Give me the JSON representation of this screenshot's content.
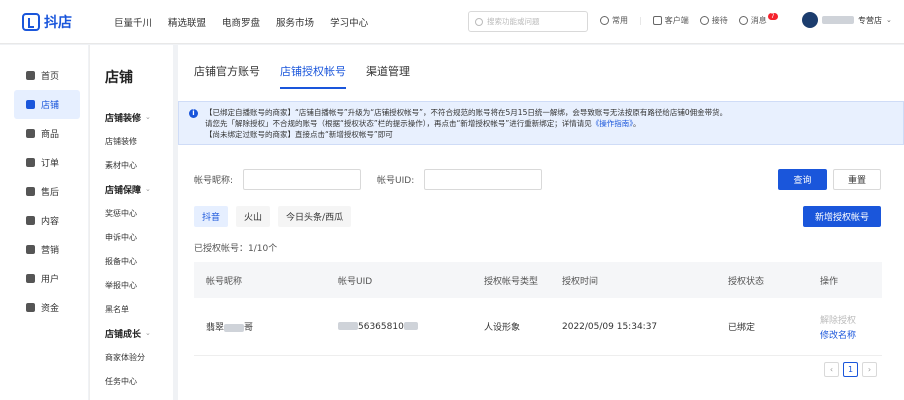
{
  "brand": {
    "name": "抖店"
  },
  "topnav": [
    "巨量千川",
    "精选联盟",
    "电商罗盘",
    "服务市场",
    "学习中心"
  ],
  "search": {
    "placeholder": "搜索功能或问题"
  },
  "tools": {
    "common": "常用",
    "customer": "客户端",
    "receive": "接待",
    "message": "消息",
    "message_badge": "7"
  },
  "user": {
    "suffix": "专营店"
  },
  "leftnav": [
    {
      "label": "首页",
      "icon": "home-icon"
    },
    {
      "label": "店铺",
      "icon": "store-icon",
      "active": true
    },
    {
      "label": "商品",
      "icon": "goods-icon"
    },
    {
      "label": "订单",
      "icon": "order-icon"
    },
    {
      "label": "售后",
      "icon": "after-sale-icon"
    },
    {
      "label": "内容",
      "icon": "content-icon"
    },
    {
      "label": "营销",
      "icon": "marketing-icon"
    },
    {
      "label": "用户",
      "icon": "user-icon"
    },
    {
      "label": "资金",
      "icon": "funds-icon"
    }
  ],
  "subnav": {
    "title": "店铺",
    "groups": [
      {
        "label": "店铺装修",
        "items": [
          "店铺装修",
          "素材中心"
        ]
      },
      {
        "label": "店铺保障",
        "items": [
          "奖惩中心",
          "申诉中心",
          "报备中心",
          "举报中心",
          "黑名单"
        ]
      },
      {
        "label": "店铺成长",
        "items": [
          "商家体验分",
          "任务中心"
        ]
      }
    ]
  },
  "tabs": [
    "店铺官方账号",
    "店铺授权帐号",
    "渠道管理"
  ],
  "notice": {
    "line1": "【已绑定自播账号的商家】“店铺自播帐号”升级为“店铺授权帐号”，不符合规范的账号将在5月15日统一解绑，会导致账号无法按原有路径给店铺0佣金带货。",
    "line2a": "请您先「解除授权」不合规的账号（根据“授权状态”栏的提示操作），再点击“新增授权帐号”进行重新绑定；详情请见",
    "line2_link": "《操作指南》",
    "line2b": "。",
    "line3": "【尚未绑定过账号的商家】直接点击“新增授权帐号”即可"
  },
  "form": {
    "nickname_label": "帐号昵称:",
    "uid_label": "帐号UID:",
    "query": "查询",
    "reset": "重置",
    "add": "新增授权帐号"
  },
  "platforms": [
    "抖音",
    "火山",
    "今日头条/西瓜"
  ],
  "count_text": "已授权帐号：1/10个",
  "table": {
    "headers": [
      "帐号昵称",
      "帐号UID",
      "授权帐号类型",
      "授权时间",
      "授权状态",
      "操作"
    ],
    "rows": [
      {
        "nick_a": "翡翠",
        "nick_b": "哥",
        "uid": "56365810",
        "type": "人设形象",
        "time": "2022/05/09 15:34:37",
        "status": "已绑定",
        "op_unbind": "解除授权",
        "op_rename": "修改名称"
      }
    ]
  },
  "pager": {
    "prev": "‹",
    "current": "1",
    "next": "›"
  }
}
